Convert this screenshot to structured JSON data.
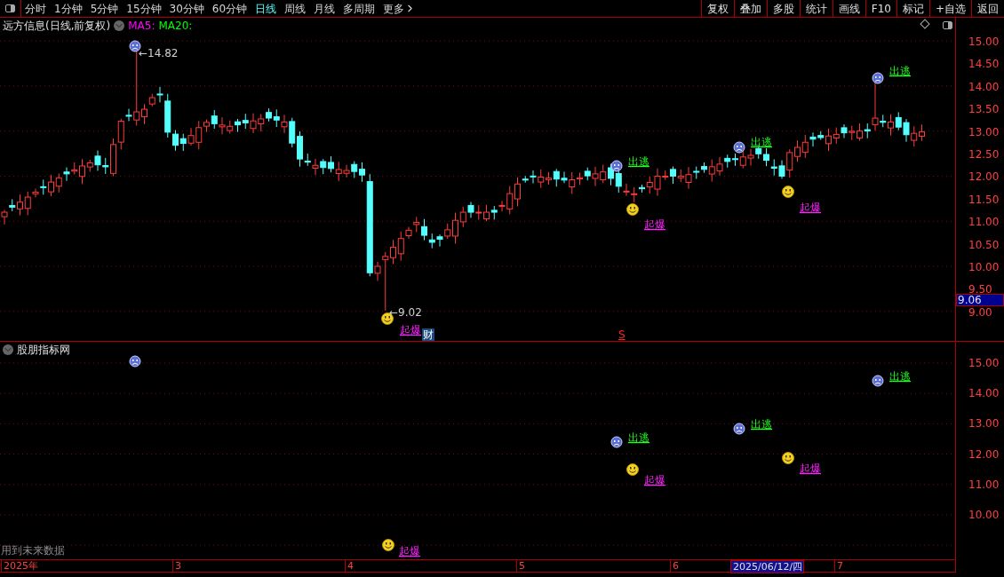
{
  "toolbar": {
    "tabs": [
      {
        "label": "分时",
        "selected": false
      },
      {
        "label": "1分钟",
        "selected": false
      },
      {
        "label": "5分钟",
        "selected": false
      },
      {
        "label": "15分钟",
        "selected": false
      },
      {
        "label": "30分钟",
        "selected": false
      },
      {
        "label": "60分钟",
        "selected": false
      },
      {
        "label": "日线",
        "selected": true
      },
      {
        "label": "周线",
        "selected": false
      },
      {
        "label": "月线",
        "selected": false
      },
      {
        "label": "多周期",
        "selected": false
      }
    ],
    "more": "更多",
    "buttons": [
      "复权",
      "叠加",
      "多股",
      "统计",
      "画线",
      "F10",
      "标记",
      "+自选",
      "返回"
    ]
  },
  "main_chart": {
    "title": "远方信息(日线,前复权)",
    "ma_labels": [
      {
        "label": "MA5:",
        "color": "#ff00ff"
      },
      {
        "label": "MA20:",
        "color": "#00ff00"
      }
    ],
    "price_axis": [
      "15.00",
      "14.50",
      "14.00",
      "13.50",
      "13.00",
      "12.50",
      "12.00",
      "11.50",
      "11.00",
      "10.50",
      "10.00",
      "9.50",
      "9.00"
    ],
    "current_price": "9.06",
    "high_label": "←14.82",
    "low_label": "←9.02",
    "event_marks": [
      {
        "kind": "finance",
        "label": "财"
      },
      {
        "kind": "signal",
        "label": "S"
      }
    ],
    "signals": [
      {
        "kind": "escape"
      },
      {
        "kind": "burst",
        "label": "起爆"
      },
      {
        "kind": "escape",
        "label": "出逃"
      },
      {
        "kind": "burst",
        "label": "起爆"
      },
      {
        "kind": "escape",
        "label": "出逃"
      },
      {
        "kind": "burst",
        "label": "起爆"
      },
      {
        "kind": "escape",
        "label": "出逃"
      }
    ]
  },
  "indicator": {
    "title": "股朋指标网",
    "axis": [
      "15.00",
      "14.00",
      "13.00",
      "12.00",
      "11.00",
      "10.00"
    ],
    "note": "用到未来数据",
    "signals": [
      {
        "kind": "escape"
      },
      {
        "kind": "escape",
        "label": "出逃"
      },
      {
        "kind": "burst",
        "label": "起爆"
      },
      {
        "kind": "escape",
        "label": "出逃"
      },
      {
        "kind": "burst",
        "label": "起爆"
      },
      {
        "kind": "escape",
        "label": "出逃"
      },
      {
        "kind": "burst",
        "label": "起爆"
      }
    ]
  },
  "date_axis": {
    "labels": [
      {
        "label": "2025年",
        "selected": false
      },
      {
        "label": "3",
        "selected": false
      },
      {
        "label": "4",
        "selected": false
      },
      {
        "label": "5",
        "selected": false
      },
      {
        "label": "6",
        "selected": false
      },
      {
        "label": "2025/06/12/四",
        "selected": true
      },
      {
        "label": "7",
        "selected": false
      }
    ]
  }
}
